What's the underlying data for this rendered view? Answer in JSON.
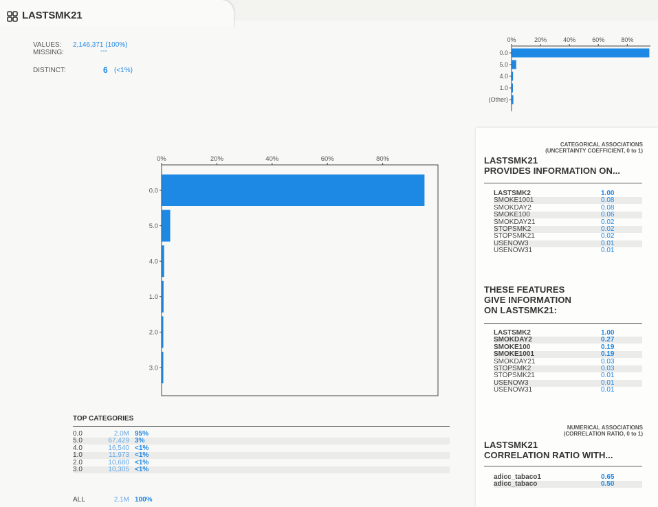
{
  "header": {
    "title": "LASTSMK21"
  },
  "stats": {
    "values_label": "VALUES:",
    "values_value": "2,146,371 (100%)",
    "missing_label": "MISSING:",
    "missing_value": "---",
    "distinct_label": "DISTINCT:",
    "distinct_count": "6",
    "distinct_pct": "(<1%)"
  },
  "mini_chart": {
    "type": "bar",
    "orientation": "horizontal",
    "categories": [
      "0.0",
      "5.0",
      "4.0",
      "1.0",
      "(Other)"
    ],
    "values": [
      95,
      3,
      0.8,
      0.6,
      1.0
    ],
    "xlim": [
      0,
      96
    ],
    "ticks": [
      "0%",
      "20%",
      "40%",
      "60%",
      "80%"
    ],
    "bar_color": "#1e88e5"
  },
  "chart_data": {
    "type": "bar",
    "orientation": "horizontal",
    "categories": [
      "0.0",
      "5.0",
      "4.0",
      "1.0",
      "2.0",
      "3.0"
    ],
    "values": [
      95,
      3,
      0.8,
      0.6,
      0.5,
      0.5
    ],
    "xlim": [
      0,
      100
    ],
    "ticks": [
      "0%",
      "20%",
      "40%",
      "60%",
      "80%"
    ],
    "bar_color": "#1e88e5"
  },
  "top_categories": {
    "title": "TOP CATEGORIES",
    "rows": [
      {
        "key": "0.0",
        "count": "2.0M",
        "pct": "95%"
      },
      {
        "key": "5.0",
        "count": "67,429",
        "pct": "3%"
      },
      {
        "key": "4.0",
        "count": "16,540",
        "pct": "<1%"
      },
      {
        "key": "1.0",
        "count": "11,973",
        "pct": "<1%"
      },
      {
        "key": "2.0",
        "count": "10,680",
        "pct": "<1%"
      },
      {
        "key": "3.0",
        "count": "10,305",
        "pct": "<1%"
      }
    ],
    "all": {
      "key": "ALL",
      "count": "2.1M",
      "pct": "100%"
    }
  },
  "associations": {
    "categorical_header": [
      "CATEGORICAL ASSOCIATIONS",
      "(UNCERTAINTY COEFFICIENT, 0 to 1)"
    ],
    "provides_title": [
      "LASTSMK21",
      "PROVIDES INFORMATION ON..."
    ],
    "provides": [
      {
        "name": "LASTSMK2",
        "value": "1.00",
        "bold": true
      },
      {
        "name": "SMOKE1001",
        "value": "0.08"
      },
      {
        "name": "SMOKDAY2",
        "value": "0.08"
      },
      {
        "name": "SMOKE100",
        "value": "0.06"
      },
      {
        "name": "SMOKDAY21",
        "value": "0.02"
      },
      {
        "name": "STOPSMK2",
        "value": "0.02"
      },
      {
        "name": "STOPSMK21",
        "value": "0.02"
      },
      {
        "name": "USENOW3",
        "value": "0.01"
      },
      {
        "name": "USENOW31",
        "value": "0.01"
      }
    ],
    "gives_title": [
      "THESE FEATURES",
      "GIVE INFORMATION",
      "ON LASTSMK21:"
    ],
    "gives": [
      {
        "name": "LASTSMK2",
        "value": "1.00",
        "bold": true
      },
      {
        "name": "SMOKDAY2",
        "value": "0.27",
        "bold": true
      },
      {
        "name": "SMOKE100",
        "value": "0.19",
        "bold": true
      },
      {
        "name": "SMOKE1001",
        "value": "0.19",
        "bold": true
      },
      {
        "name": "SMOKDAY21",
        "value": "0.03"
      },
      {
        "name": "STOPSMK2",
        "value": "0.03"
      },
      {
        "name": "STOPSMK21",
        "value": "0.01"
      },
      {
        "name": "USENOW3",
        "value": "0.01"
      },
      {
        "name": "USENOW31",
        "value": "0.01"
      }
    ],
    "numerical_header": [
      "NUMERICAL ASSOCIATIONS",
      "(CORRELATION RATIO, 0 to 1)"
    ],
    "corr_title": [
      "LASTSMK21",
      "CORRELATION RATIO WITH..."
    ],
    "corr": [
      {
        "name": "adicc_tabaco1",
        "value": "0.65",
        "bold": true
      },
      {
        "name": "adicc_tabaco",
        "value": "0.50",
        "bold": true
      }
    ]
  },
  "colors": {
    "accent": "#1e88e5",
    "light_accent": "#64a8e8",
    "background": "#f8f8f6"
  }
}
